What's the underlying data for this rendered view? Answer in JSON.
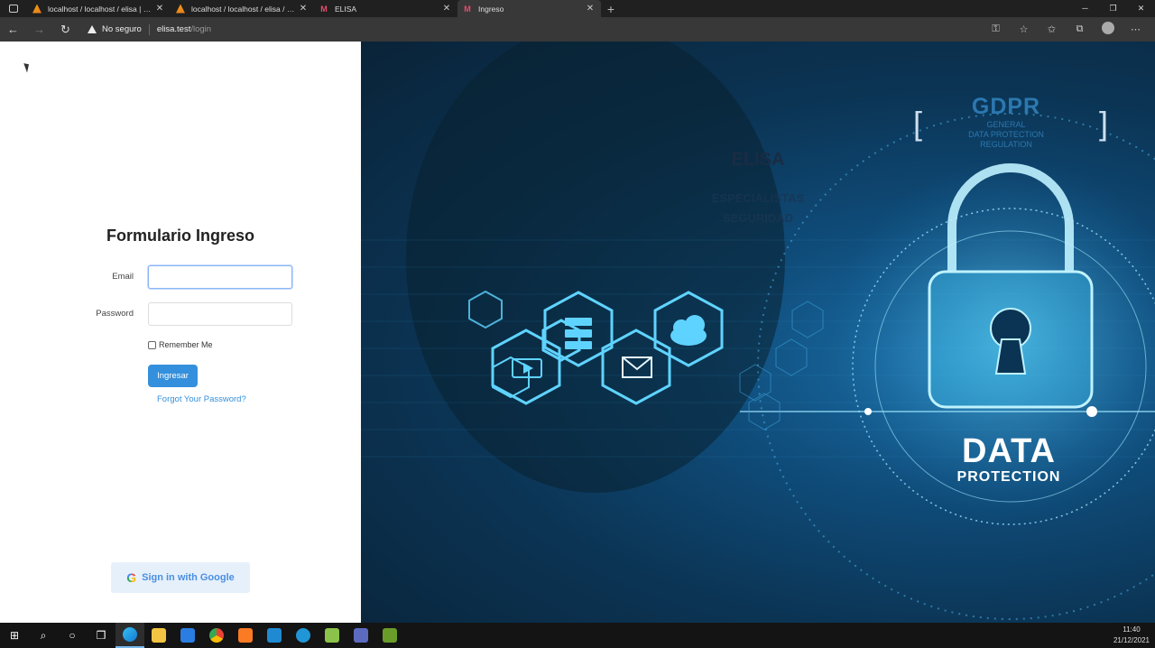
{
  "browser": {
    "tabs": [
      {
        "title": "localhost / localhost / elisa | php",
        "icon": "phpmyadmin-icon",
        "active": false
      },
      {
        "title": "localhost / localhost / elisa / use",
        "icon": "phpmyadmin-icon",
        "active": false
      },
      {
        "title": "ELISA",
        "icon": "elisa-icon",
        "active": false
      },
      {
        "title": "Ingreso",
        "icon": "elisa-icon",
        "active": true
      }
    ],
    "new_tab_label": "+",
    "security_label": "No seguro",
    "url_host": "elisa.test",
    "url_path": "/login"
  },
  "login": {
    "title": "Formulario Ingreso",
    "email_label": "Email",
    "email_value": "",
    "password_label": "Password",
    "password_value": "",
    "remember_label": "Remember Me",
    "remember_checked": false,
    "submit_label": "Ingresar",
    "forgot_label": "Forgot Your Password?",
    "google_label": "Sign in with Google"
  },
  "hero": {
    "brand": "ELISA",
    "tagline_line1": "ESPECIALISTAS",
    "tagline_line2": "SEGURIDAD",
    "gdpr_title": "GDPR",
    "gdpr_line1": "GENERAL",
    "gdpr_line2": "DATA PROTECTION",
    "gdpr_line3": "REGULATION",
    "dp_line1": "DATA",
    "dp_line2": "PROTECTION"
  },
  "taskbar": {
    "time": "11:40",
    "date": "21/12/2021"
  },
  "colors": {
    "primary": "#3490dc",
    "hero_dark": "#0a2338",
    "hero_glow": "#5fd3ff"
  }
}
